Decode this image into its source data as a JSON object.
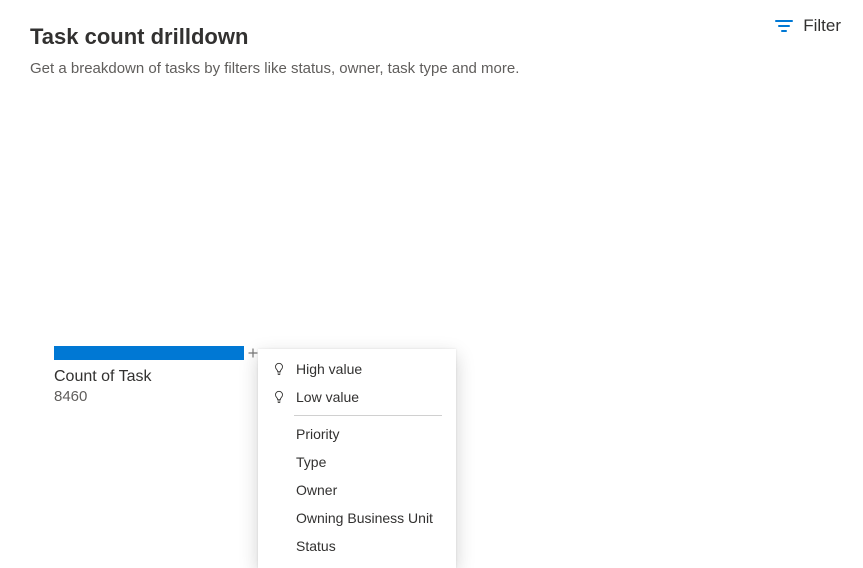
{
  "header": {
    "title": "Task count drilldown",
    "subtitle": "Get a breakdown of tasks by filters like status, owner, task type and more."
  },
  "filter": {
    "label": "Filter"
  },
  "chart_data": {
    "type": "bar",
    "categories": [
      "Count of Task"
    ],
    "values": [
      8460
    ],
    "title": "",
    "xlabel": "",
    "ylabel": ""
  },
  "measure": {
    "label": "Count of Task",
    "value": "8460"
  },
  "dropdown": {
    "insights": [
      {
        "label": "High value"
      },
      {
        "label": "Low value"
      }
    ],
    "fields": [
      {
        "label": "Priority"
      },
      {
        "label": "Type"
      },
      {
        "label": "Owner"
      },
      {
        "label": "Owning Business Unit"
      },
      {
        "label": "Status"
      }
    ]
  }
}
